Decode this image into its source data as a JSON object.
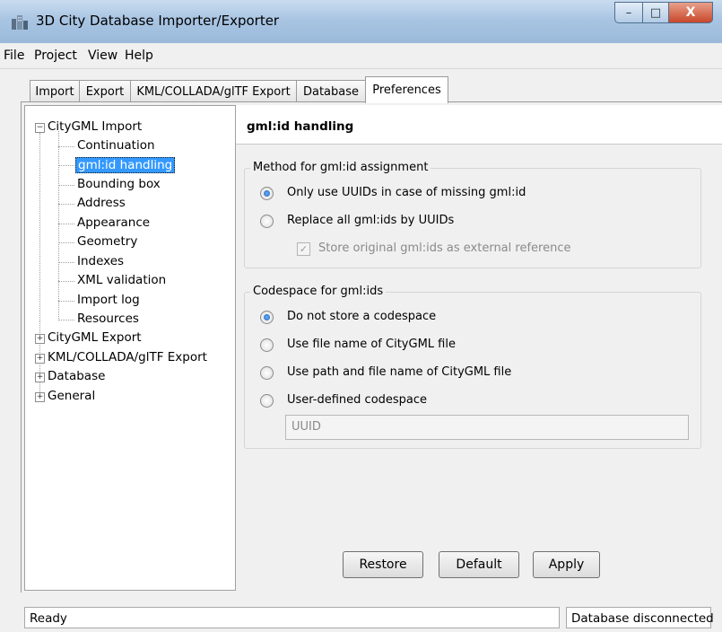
{
  "window": {
    "title": "3D City Database Importer/Exporter",
    "minimize_glyph": "–",
    "maximize_glyph": "□",
    "close_glyph": "X"
  },
  "menu": [
    "File",
    "Project",
    "View",
    "Help"
  ],
  "tabs": [
    {
      "label": "Import"
    },
    {
      "label": "Export"
    },
    {
      "label": "KML/COLLADA/glTF Export"
    },
    {
      "label": "Database"
    },
    {
      "label": "Preferences",
      "active": true
    }
  ],
  "tree": {
    "root": "CityGML Import",
    "children": [
      "Continuation",
      "gml:id handling",
      "Bounding box",
      "Address",
      "Appearance",
      "Geometry",
      "Indexes",
      "XML validation",
      "Import log",
      "Resources"
    ],
    "selected": "gml:id handling",
    "collapsed": [
      "CityGML Export",
      "KML/COLLADA/glTF Export",
      "Database",
      "General"
    ],
    "expanded_glyph": "−",
    "collapsed_glyph": "+"
  },
  "panel": {
    "title": "gml:id handling",
    "method_group": {
      "title": "Method for gml:id assignment",
      "options": [
        {
          "label": "Only use UUIDs in case of missing gml:id",
          "checked": true
        },
        {
          "label": "Replace all gml:ids by UUIDs",
          "checked": false
        }
      ],
      "checkbox": {
        "label": "Store original gml:ids as external reference",
        "checked": true,
        "disabled": true,
        "glyph": "✓"
      }
    },
    "codespace_group": {
      "title": "Codespace for gml:ids",
      "options": [
        {
          "label": "Do not store a codespace",
          "checked": true
        },
        {
          "label": "Use file name of CityGML file",
          "checked": false
        },
        {
          "label": "Use path and file name of CityGML file",
          "checked": false
        },
        {
          "label": "User-defined codespace",
          "checked": false
        }
      ],
      "field_value": "UUID"
    },
    "buttons": {
      "restore": "Restore",
      "default": "Default",
      "apply": "Apply"
    }
  },
  "status": {
    "left": "Ready",
    "right": "Database disconnected"
  },
  "colors": {
    "selection": "#3399ff",
    "radio_fill": "#1a5fb0",
    "close_button": "#c8472b"
  }
}
